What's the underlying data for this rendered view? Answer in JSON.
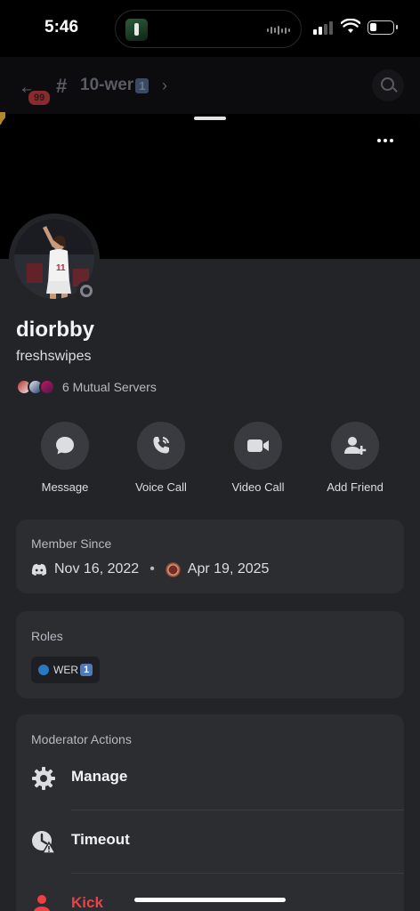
{
  "status_bar": {
    "time": "5:46"
  },
  "channel_header": {
    "unread_count": "99",
    "hash": "#",
    "channel_name": "10-wer",
    "channel_suffix": "1",
    "chevron": "›"
  },
  "profile": {
    "display_name": "diorbby",
    "username": "freshswipes",
    "mutual_servers": "6 Mutual Servers"
  },
  "actions": [
    {
      "label": "Message",
      "icon": "chat-bubble-icon"
    },
    {
      "label": "Voice Call",
      "icon": "phone-icon"
    },
    {
      "label": "Video Call",
      "icon": "video-camera-icon"
    },
    {
      "label": "Add Friend",
      "icon": "add-friend-icon"
    }
  ],
  "member_since": {
    "title": "Member Since",
    "discord_date": "Nov 16, 2022",
    "separator": "•",
    "server_date": "Apr 19, 2025"
  },
  "roles": {
    "title": "Roles",
    "items": [
      {
        "name": "WER",
        "suffix": "1",
        "color": "#2a78c2"
      }
    ]
  },
  "moderator_actions": {
    "title": "Moderator Actions",
    "items": [
      {
        "label": "Manage",
        "icon": "gear-icon"
      },
      {
        "label": "Timeout",
        "icon": "timeout-clock-icon"
      },
      {
        "label": "Kick",
        "icon": "kick-user-icon",
        "color": "#f23f43"
      }
    ]
  },
  "colors": {
    "sheet_bg": "#232428",
    "card_bg": "#2b2d31",
    "danger": "#f23f43"
  }
}
